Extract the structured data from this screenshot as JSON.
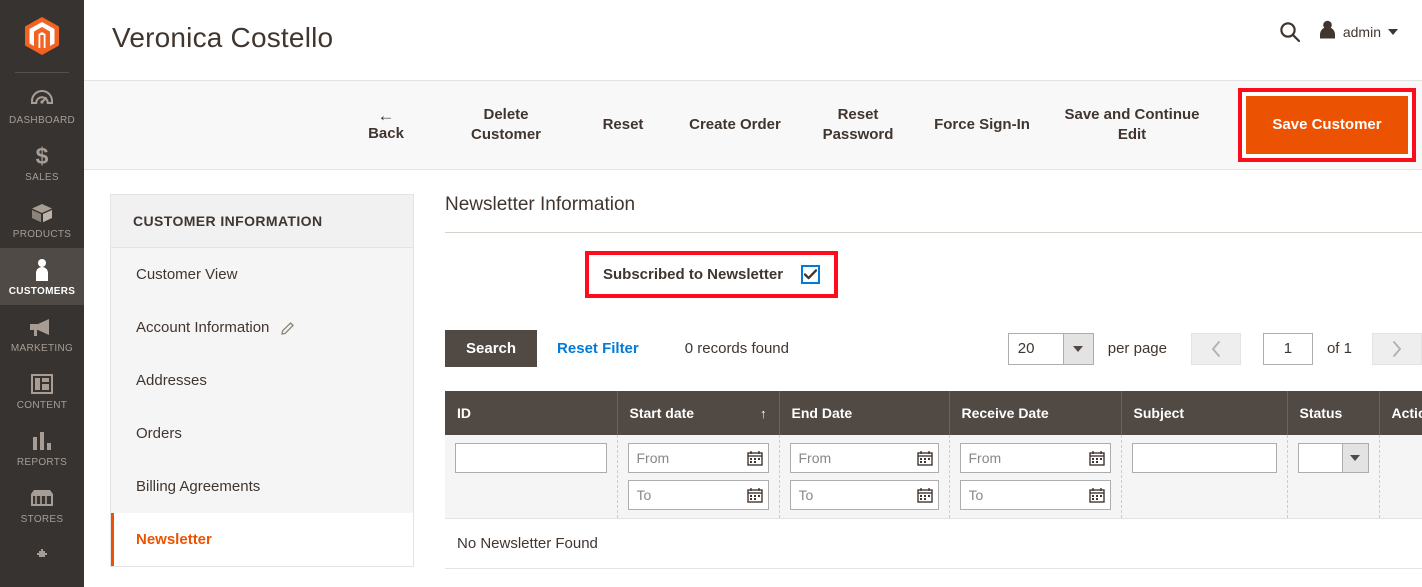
{
  "admin_nav": {
    "logo_name": "magento-logo-icon",
    "items": [
      {
        "label": "Dashboard",
        "icon": "dashboard-icon",
        "active": false
      },
      {
        "label": "Sales",
        "icon": "dollar-icon",
        "active": false
      },
      {
        "label": "Products",
        "icon": "box-icon",
        "active": false
      },
      {
        "label": "Customers",
        "icon": "person-icon",
        "active": true
      },
      {
        "label": "Marketing",
        "icon": "megaphone-icon",
        "active": false
      },
      {
        "label": "Content",
        "icon": "layout-icon",
        "active": false
      },
      {
        "label": "Reports",
        "icon": "bar-chart-icon",
        "active": false
      },
      {
        "label": "Stores",
        "icon": "storefront-icon",
        "active": false
      },
      {
        "label": "",
        "icon": "gear-icon",
        "active": false
      }
    ]
  },
  "header": {
    "title": "Veronica Costello",
    "search_icon": "search-icon",
    "user_icon": "user-avatar-icon",
    "user_name": "admin",
    "caret_icon": "chevron-down-icon"
  },
  "toolbar": {
    "back_arrow": "←",
    "back_label": "Back",
    "delete_customer_label": "Delete Customer",
    "reset_label": "Reset",
    "create_order_label": "Create Order",
    "reset_password_label": "Reset Password",
    "force_sign_in_label": "Force Sign-In",
    "save_continue_label": "Save and Continue Edit",
    "save_customer_label": "Save Customer",
    "save_customer_color": "#eb5202",
    "highlight_color": "#fc0d1b"
  },
  "customer_info": {
    "title": "Customer Information",
    "items": [
      {
        "label": "Customer View",
        "active": false,
        "edit_icon": false
      },
      {
        "label": "Account Information",
        "active": false,
        "edit_icon": true
      },
      {
        "label": "Addresses",
        "active": false,
        "edit_icon": false
      },
      {
        "label": "Orders",
        "active": false,
        "edit_icon": false
      },
      {
        "label": "Billing Agreements",
        "active": false,
        "edit_icon": false
      },
      {
        "label": "Newsletter",
        "active": true,
        "edit_icon": false
      }
    ]
  },
  "newsletter": {
    "heading": "Newsletter Information",
    "subscribe_label": "Subscribed to Newsletter",
    "subscribe_checked": true,
    "checkbox_accent": "#007bdb"
  },
  "grid_controls": {
    "search_label": "Search",
    "reset_filter_label": "Reset Filter",
    "records_found": "0 records found",
    "per_page_value": "20",
    "per_page_label": "per page",
    "prev_icon": "chevron-left-icon",
    "next_icon": "chevron-right-icon",
    "page_number": "1",
    "page_total": "of 1"
  },
  "grid": {
    "columns": [
      {
        "label": "ID",
        "sorted": false
      },
      {
        "label": "Start date",
        "sorted": true,
        "sort_icon": "↑"
      },
      {
        "label": "End Date",
        "sorted": false
      },
      {
        "label": "Receive Date",
        "sorted": false
      },
      {
        "label": "Subject",
        "sorted": false
      },
      {
        "label": "Status",
        "sorted": false
      },
      {
        "label": "Action",
        "sorted": false
      }
    ],
    "filters": {
      "id_value": "",
      "date_from_placeholder": "From",
      "date_to_placeholder": "To",
      "subject_value": "",
      "status_value": "",
      "calendar_icon": "calendar-icon"
    },
    "empty_message": "No Newsletter Found"
  }
}
